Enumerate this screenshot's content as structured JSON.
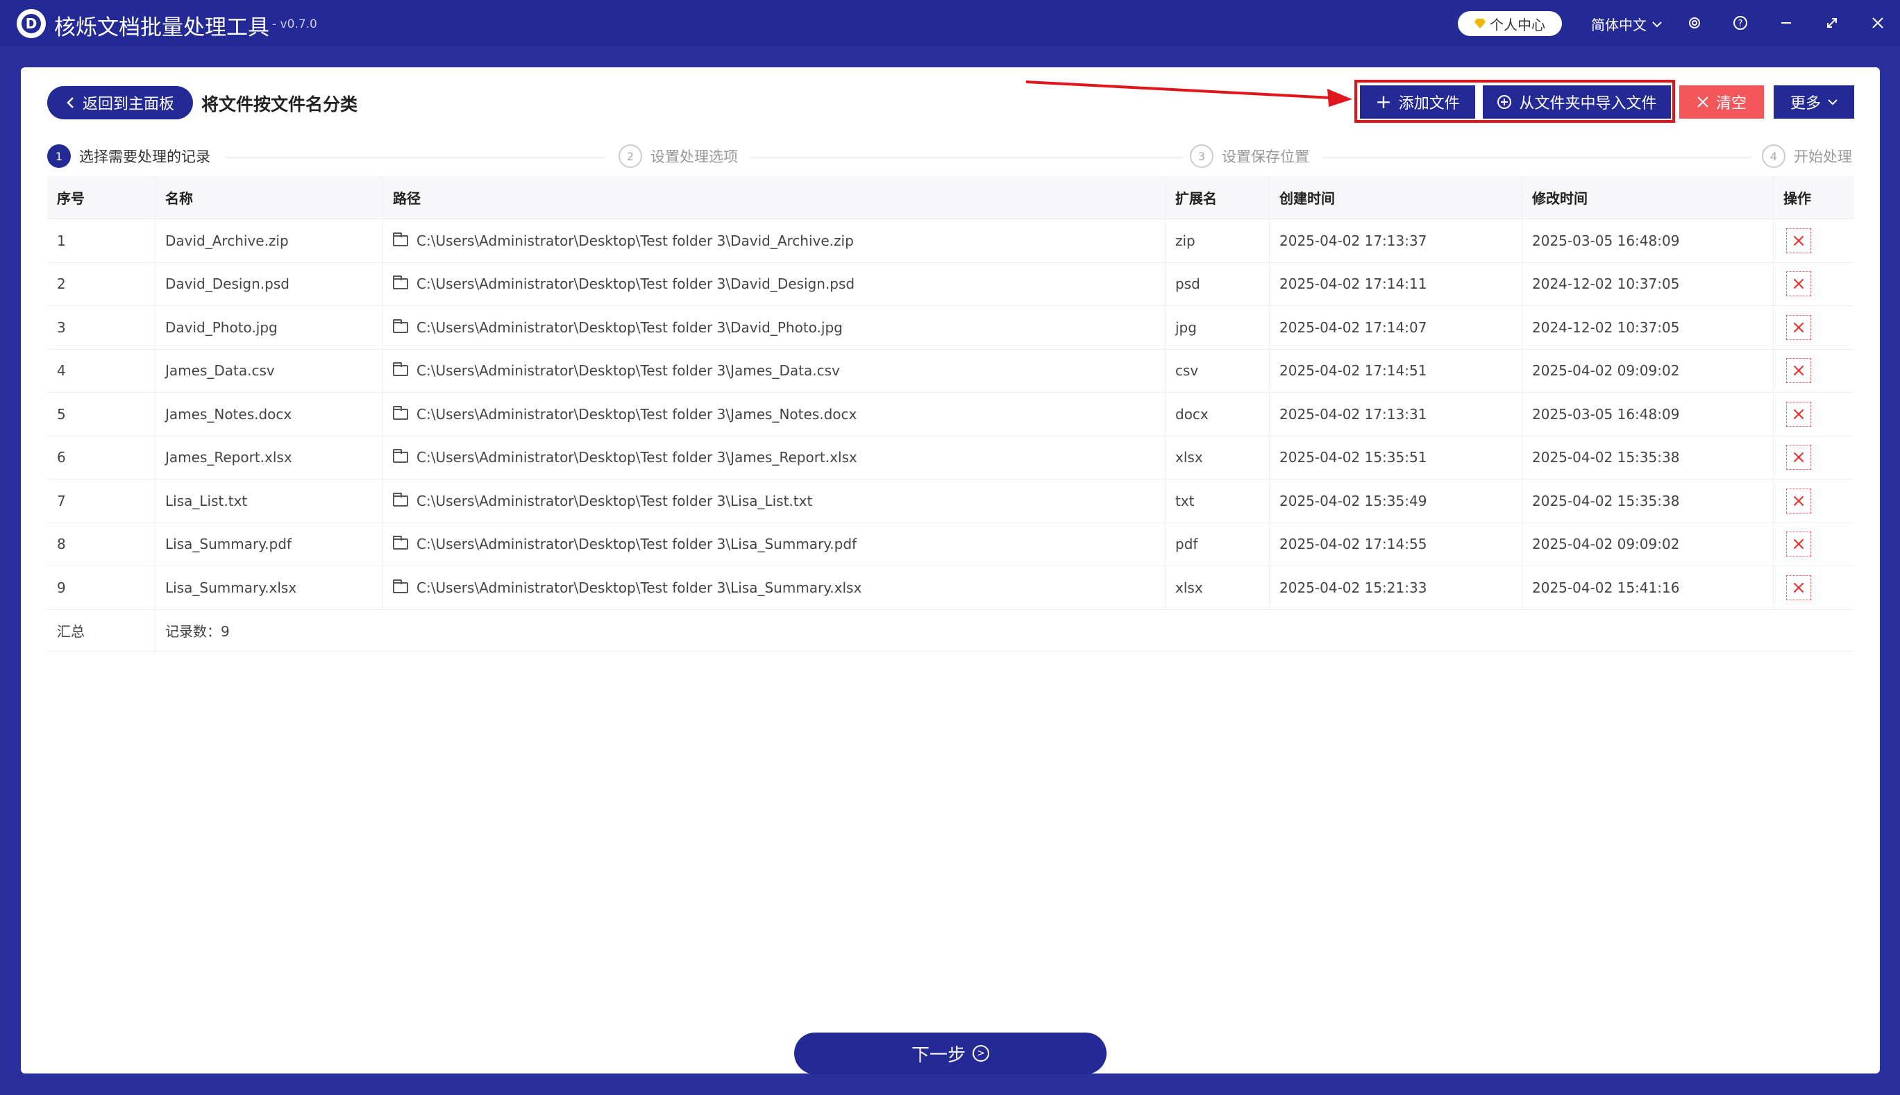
{
  "window": {
    "title": "核烁文档批量处理工具",
    "version": "- v0.7.0",
    "user_center": "个人中心",
    "language": "简体中文",
    "icons": [
      "gear-icon",
      "help-icon",
      "minimize-icon",
      "maximize-icon",
      "close-icon"
    ]
  },
  "toolbar": {
    "back_label": "返回到主面板",
    "page_title": "将文件按文件名分类",
    "add_file": "添加文件",
    "import_folder": "从文件夹中导入文件",
    "clear": "清空",
    "more": "更多"
  },
  "steps": [
    {
      "num": "1",
      "label": "选择需要处理的记录",
      "active": true
    },
    {
      "num": "2",
      "label": "设置处理选项",
      "active": false
    },
    {
      "num": "3",
      "label": "设置保存位置",
      "active": false
    },
    {
      "num": "4",
      "label": "开始处理",
      "active": false
    }
  ],
  "table": {
    "headers": [
      "序号",
      "名称",
      "路径",
      "扩展名",
      "创建时间",
      "修改时间",
      "操作"
    ],
    "rows": [
      {
        "no": "1",
        "name": "David_Archive.zip",
        "path": "C:\\Users\\Administrator\\Desktop\\Test folder 3\\David_Archive.zip",
        "ext": "zip",
        "created": "2025-04-02 17:13:37",
        "modified": "2025-03-05 16:48:09"
      },
      {
        "no": "2",
        "name": "David_Design.psd",
        "path": "C:\\Users\\Administrator\\Desktop\\Test folder 3\\David_Design.psd",
        "ext": "psd",
        "created": "2025-04-02 17:14:11",
        "modified": "2024-12-02 10:37:05"
      },
      {
        "no": "3",
        "name": "David_Photo.jpg",
        "path": "C:\\Users\\Administrator\\Desktop\\Test folder 3\\David_Photo.jpg",
        "ext": "jpg",
        "created": "2025-04-02 17:14:07",
        "modified": "2024-12-02 10:37:05"
      },
      {
        "no": "4",
        "name": "James_Data.csv",
        "path": "C:\\Users\\Administrator\\Desktop\\Test folder 3\\James_Data.csv",
        "ext": "csv",
        "created": "2025-04-02 17:14:51",
        "modified": "2025-04-02 09:09:02"
      },
      {
        "no": "5",
        "name": "James_Notes.docx",
        "path": "C:\\Users\\Administrator\\Desktop\\Test folder 3\\James_Notes.docx",
        "ext": "docx",
        "created": "2025-04-02 17:13:31",
        "modified": "2025-03-05 16:48:09"
      },
      {
        "no": "6",
        "name": "James_Report.xlsx",
        "path": "C:\\Users\\Administrator\\Desktop\\Test folder 3\\James_Report.xlsx",
        "ext": "xlsx",
        "created": "2025-04-02 15:35:51",
        "modified": "2025-04-02 15:35:38"
      },
      {
        "no": "7",
        "name": "Lisa_List.txt",
        "path": "C:\\Users\\Administrator\\Desktop\\Test folder 3\\Lisa_List.txt",
        "ext": "txt",
        "created": "2025-04-02 15:35:49",
        "modified": "2025-04-02 15:35:38"
      },
      {
        "no": "8",
        "name": "Lisa_Summary.pdf",
        "path": "C:\\Users\\Administrator\\Desktop\\Test folder 3\\Lisa_Summary.pdf",
        "ext": "pdf",
        "created": "2025-04-02 17:14:55",
        "modified": "2025-04-02 09:09:02"
      },
      {
        "no": "9",
        "name": "Lisa_Summary.xlsx",
        "path": "C:\\Users\\Administrator\\Desktop\\Test folder 3\\Lisa_Summary.xlsx",
        "ext": "xlsx",
        "created": "2025-04-02 15:21:33",
        "modified": "2025-04-02 15:41:16"
      }
    ],
    "summary_label": "汇总",
    "summary_value": "记录数：9"
  },
  "footer": {
    "next_label": "下一步"
  },
  "colors": {
    "primary": "#232a96",
    "danger": "#f4575a",
    "highlight": "#e0161c"
  }
}
